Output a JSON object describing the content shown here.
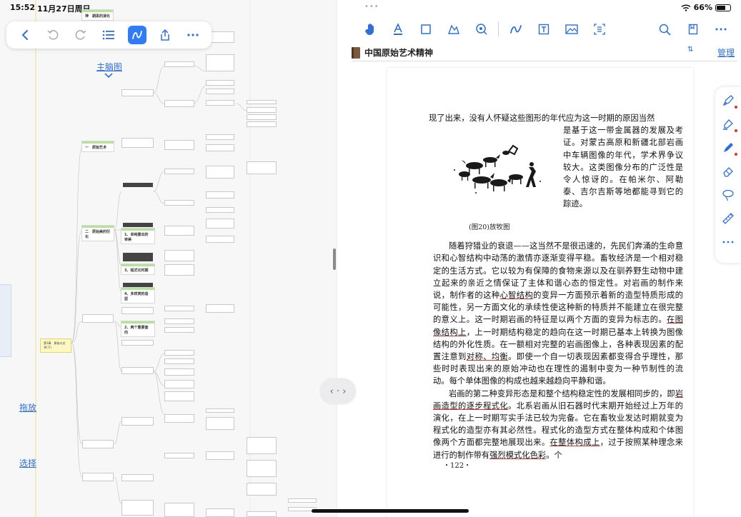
{
  "status": {
    "time": "15:52",
    "date": "11月27日周日",
    "battery_percent": "66%",
    "battery_level": 0.66,
    "multitask_dots": "•••"
  },
  "left_toolbar": {
    "icons": [
      "back-icon",
      "undo-icon",
      "redo-icon",
      "list-icon",
      "pen-icon",
      "share-icon",
      "more-icon"
    ],
    "accent": "#2f7cf6"
  },
  "mindmap": {
    "link_label": "主脑图",
    "drag_label": "拖放",
    "select_label": "选择",
    "root_label": "第1章　原始与艺术(下)",
    "titles": [
      {
        "label": "一　原始艺术"
      },
      {
        "label": "二　原始美的衍化"
      },
      {
        "label": "2、两个重要面向"
      }
    ],
    "subtitles": [
      {
        "label": "1、单纯重出的审美"
      },
      {
        "label": "3、程式化时期"
      },
      {
        "label": "4、多样类的造型"
      }
    ],
    "top_title": "神　期思的演化"
  },
  "right_toolbar": {
    "icons": [
      "hand-icon",
      "text-underline-icon",
      "rectangle-icon",
      "map-icon",
      "stamp-icon",
      "pen-wave-icon",
      "text-box-icon",
      "image-icon",
      "ocr-icon",
      "search-icon",
      "bookmark-icon",
      "more-icon"
    ]
  },
  "document": {
    "title": "中国原始艺术精神",
    "sort_icon": "⇅",
    "manage_label": "管理"
  },
  "page": {
    "line1": "现了出来，没有人怀疑这些图形的年代应为这一时期的原因当然",
    "float_text": "是基于这一带金属器的发展及考证。对蒙古高原和新疆北部岩画中车辆图像的年代，学术界争议较大。这类图像分布的广泛性是令人惊讶的。在帕米尔、阿勒泰、吉尔吉斯等地都能寻到它的踪迹。",
    "caption": "(图20)放牧图",
    "para1_start": "随着狩猎业的衰退——这当然不是很迅速的，先民们奔涌的生命意识和心智结构中动荡的激情亦逐渐变得平稳。畜牧经济是一个相对稳定的生活方式。它以较为有保障的食物来源以及在驯养野生动物中建立起来的亲近之情保证了主体和谐心态的恒定性。对岩画的制作来说，制作者的这种",
    "hl1": "心智结构",
    "para1_mid": "的变异一方面预示着新的造型特质形成的可能性，另一方面文化的承续性使这种新的特质并不能建立在很完整的意义上。这一时期岩画的特征是以两个方面的变异为标志的。",
    "hl2": "在图像结构上",
    "para1_end": "，上一时期结构稳定的趋向在这一时期已基本上转换为图像结构的外化性质。在一额相对完整的岩画图像上，各种表现因素的配置注意到",
    "hl3": "对称、均衡",
    "para1_tail": "。即使一个自一切表现因素都变得合乎理性，那些时时表现出来的原始冲动也在理性的遏制中变为一种节制性的流动。每个单体图像的构成也越来越趋向平静和谐。",
    "para2_start": "岩画的第二种变异形态是和整个结构稳定性的发展相同步的，即",
    "hl4": "岩画造型的逐步程式化",
    "para2_mid": "。北系岩画从旧石器时代末期开始经过上万年的演化，在上一时期写实手法已较为完备。它在畜牧业发达时期就变为程式化的造型亦有其必然性。程式化的造型方式在整体构成和个体图像两个方面都完整地展现出来。",
    "hl5": "在整体构成上",
    "para2_end": "，过于按照某种理念来进行的制作带有",
    "hl6": "强烈模式化色彩",
    "para2_tail": "。个",
    "page_number": "・122・"
  },
  "side_tools": {
    "icons": [
      "fountain-pen-icon",
      "highlighter-icon",
      "marker-icon",
      "eraser-icon",
      "lasso-icon",
      "ruler-icon",
      "more-icon"
    ],
    "dot_color": "#e03030"
  },
  "center_swap_label": "‹ · ›"
}
